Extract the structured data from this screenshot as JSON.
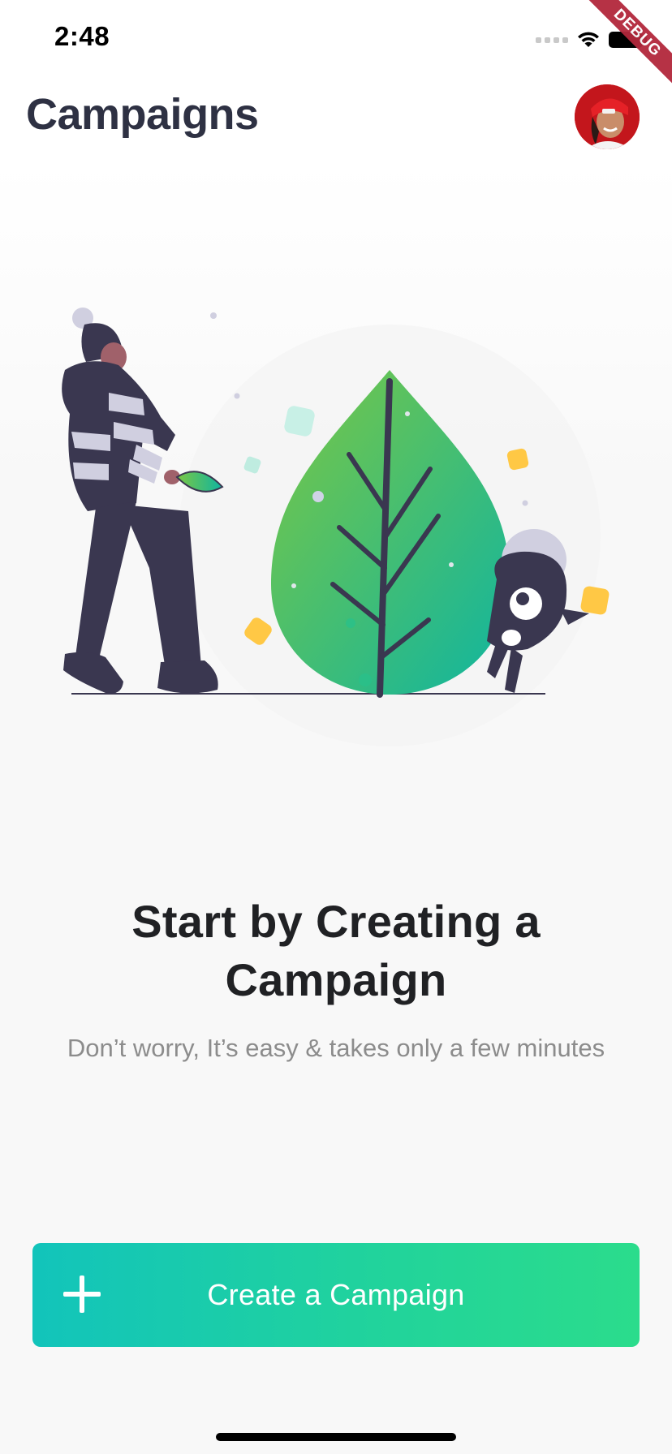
{
  "status_bar": {
    "time": "2:48"
  },
  "debug_banner": "DEBUG",
  "header": {
    "title": "Campaigns"
  },
  "empty_state": {
    "title": "Start by Creating a Campaign",
    "subtitle": "Don’t worry, It’s easy & takes only a few minutes"
  },
  "cta": {
    "label": "Create a Campaign",
    "icon": "plus-icon"
  },
  "colors": {
    "title_text": "#2e3143",
    "cta_gradient_start": "#12c4bb",
    "cta_gradient_end": "#2bdc8c",
    "leaf_green": "#6cc04a",
    "leaf_teal": "#14b59c",
    "figure_dark": "#3a3750",
    "accent_yellow": "#ffc845"
  }
}
